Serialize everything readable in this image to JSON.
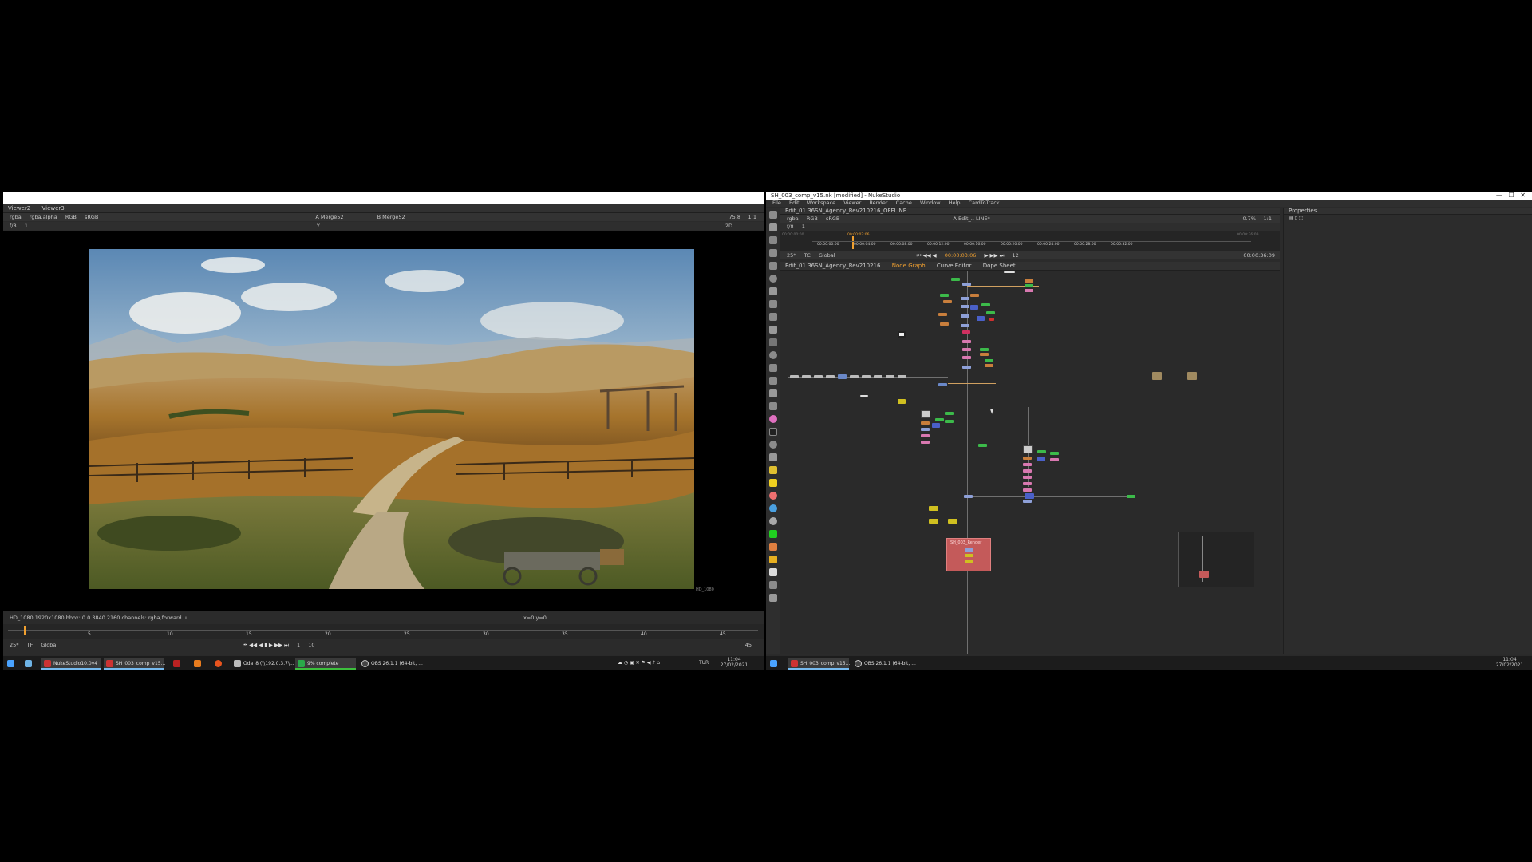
{
  "left": {
    "viewer_tabs": [
      "Viewer2",
      "Viewer3"
    ],
    "controls": {
      "channels": "rgba",
      "alpha": "rgba.alpha",
      "colorspace": "RGB",
      "lut": "sRGB",
      "input_a": "A  Merge52",
      "input_b": "B  Merge52",
      "zoom": "75.8",
      "ratio": "1:1",
      "frame_display": "f/8",
      "frame_value": "1",
      "y_value": "Y",
      "mode": "2D"
    },
    "status_line": "HD_1080 1920x1080  bbox: 0 0 3840 2160 channels: rgba,forward.u",
    "coord_readout": "x=0 y=0",
    "format_label": "HD_1080",
    "timeline_ticks": [
      "5",
      "10",
      "15",
      "20",
      "25",
      "30",
      "35",
      "40",
      "45"
    ],
    "timeline_end": "45",
    "playback": {
      "fps": "25*",
      "tc": "TF",
      "global": "Global",
      "frame": "1",
      "step": "10"
    },
    "taskbar_items": [
      {
        "label": "NukeStudio10.0v4",
        "icon": "nuke-icon"
      },
      {
        "label": "SH_003_comp_v15...",
        "icon": "nuke-icon"
      },
      {
        "label": "",
        "icon": "nuke-small-icon"
      },
      {
        "label": "",
        "icon": "sound-icon"
      },
      {
        "label": "",
        "icon": "firefox-icon"
      },
      {
        "label": "Oda_8 (\\\\192.0.3.7\\...",
        "icon": "folder-icon"
      },
      {
        "label": "9% complete",
        "icon": "progress-icon"
      },
      {
        "label": "OBS 26.1.1 (64-bit, ...",
        "icon": "obs-icon"
      }
    ],
    "tray": {
      "lang": "TUR",
      "time": "11:04",
      "date": "27/02/2021"
    }
  },
  "right": {
    "title": "SH_003_comp_v15.nk [modified] - NukeStudio",
    "menu": [
      "File",
      "Edit",
      "Workspace",
      "Viewer",
      "Render",
      "Cache",
      "Window",
      "Help",
      "CardToTrack"
    ],
    "viewer_tab": "Edit_01 36SN_Agency_Rev210216_OFFLINE",
    "controls": {
      "channels": "rgba",
      "colorspace": "RGB",
      "lut": "sRGB",
      "input_a": "A  Edit_.. LINE*",
      "zoom": "0.7%",
      "ratio": "1:1",
      "frame_display": "f/8",
      "frame_value": "1"
    },
    "timeline": {
      "start_tc": "00:00:00:00",
      "end_tc": "00:00:36:09",
      "current_tc": "00:00:03:06",
      "marker_tc": "00:00:02:06",
      "ticks": [
        "00:00:00:00",
        "00:00:04:00",
        "00:00:08:00",
        "00:00:12:00",
        "00:00:16:00",
        "00:00:20:00",
        "00:00:24:00",
        "00:00:28:00",
        "00:00:32:00",
        "00:00:36:09"
      ]
    },
    "playback": {
      "fps": "25*",
      "tc": "TC",
      "global": "Global",
      "step": "12",
      "duration": "00:00:36:09"
    },
    "panel_tabs": [
      {
        "label": "Edit_01 36SN_Agency_Rev210216",
        "active": false
      },
      {
        "label": "Node Graph",
        "active": true
      },
      {
        "label": "Curve Editor",
        "active": false
      },
      {
        "label": "Dope Sheet",
        "active": false
      }
    ],
    "properties_tab": "Properties",
    "backdrop_label": "SH_003_Render",
    "taskbar_items": [
      {
        "label": "SH_003_comp_v15...",
        "icon": "nuke-icon"
      },
      {
        "label": "OBS 26.1.1 (64-bit, ...",
        "icon": "obs-icon"
      }
    ],
    "tray": {
      "time": "11:04",
      "date": "27/02/2021"
    },
    "colors": {
      "accent": "#f0a030",
      "backdrop": "#c45a5a",
      "node_bg": "#3a3a3a"
    }
  }
}
